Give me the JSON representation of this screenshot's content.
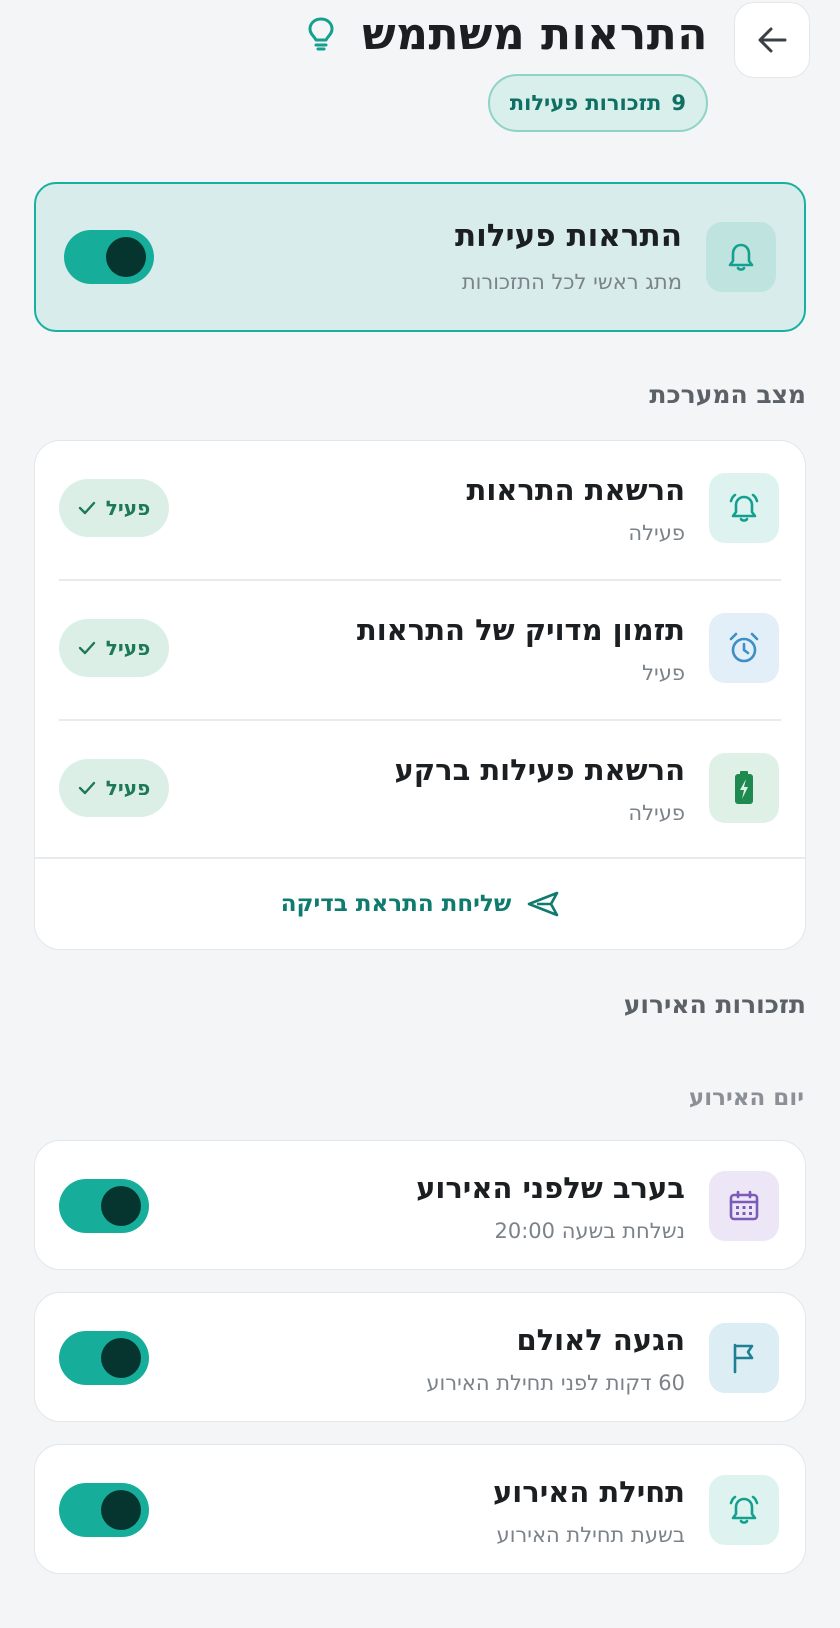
{
  "header": {
    "title": "התראות משתמש",
    "active_count": "9",
    "active_count_label": "תזכורות פעילות"
  },
  "master": {
    "title": "התראות פעילות",
    "subtitle": "מתג ראשי לכל התזכורות",
    "enabled": true
  },
  "system_status": {
    "heading": "מצב המערכת",
    "rows": [
      {
        "title": "הרשאת התראות",
        "subtitle": "פעילה",
        "status": "פעיל",
        "icon": "bell-ring-icon"
      },
      {
        "title": "תזמון מדויק של התראות",
        "subtitle": "פעיל",
        "status": "פעיל",
        "icon": "alarm-clock-icon"
      },
      {
        "title": "הרשאת פעילות ברקע",
        "subtitle": "פעילה",
        "status": "פעיל",
        "icon": "battery-charging-icon"
      }
    ],
    "test_button": "שליחת התראת בדיקה"
  },
  "event_reminders": {
    "heading": "תזכורות האירוע",
    "group_heading": "יום האירוע",
    "items": [
      {
        "title": "בערב שלפני האירוע",
        "subtitle": "נשלחת בשעה 20:00",
        "enabled": true,
        "icon": "calendar-icon"
      },
      {
        "title": "הגעה לאולם",
        "subtitle": "60 דקות לפני תחילת האירוע",
        "enabled": true,
        "icon": "flag-icon"
      },
      {
        "title": "תחילת האירוע",
        "subtitle": "בשעת תחילת האירוע",
        "enabled": true,
        "icon": "bell-ring-icon"
      }
    ]
  },
  "colors": {
    "accent": "#16ae9a",
    "accent_dark": "#063530",
    "background": "#f3f5f7",
    "status_green": "#1d7a57"
  }
}
